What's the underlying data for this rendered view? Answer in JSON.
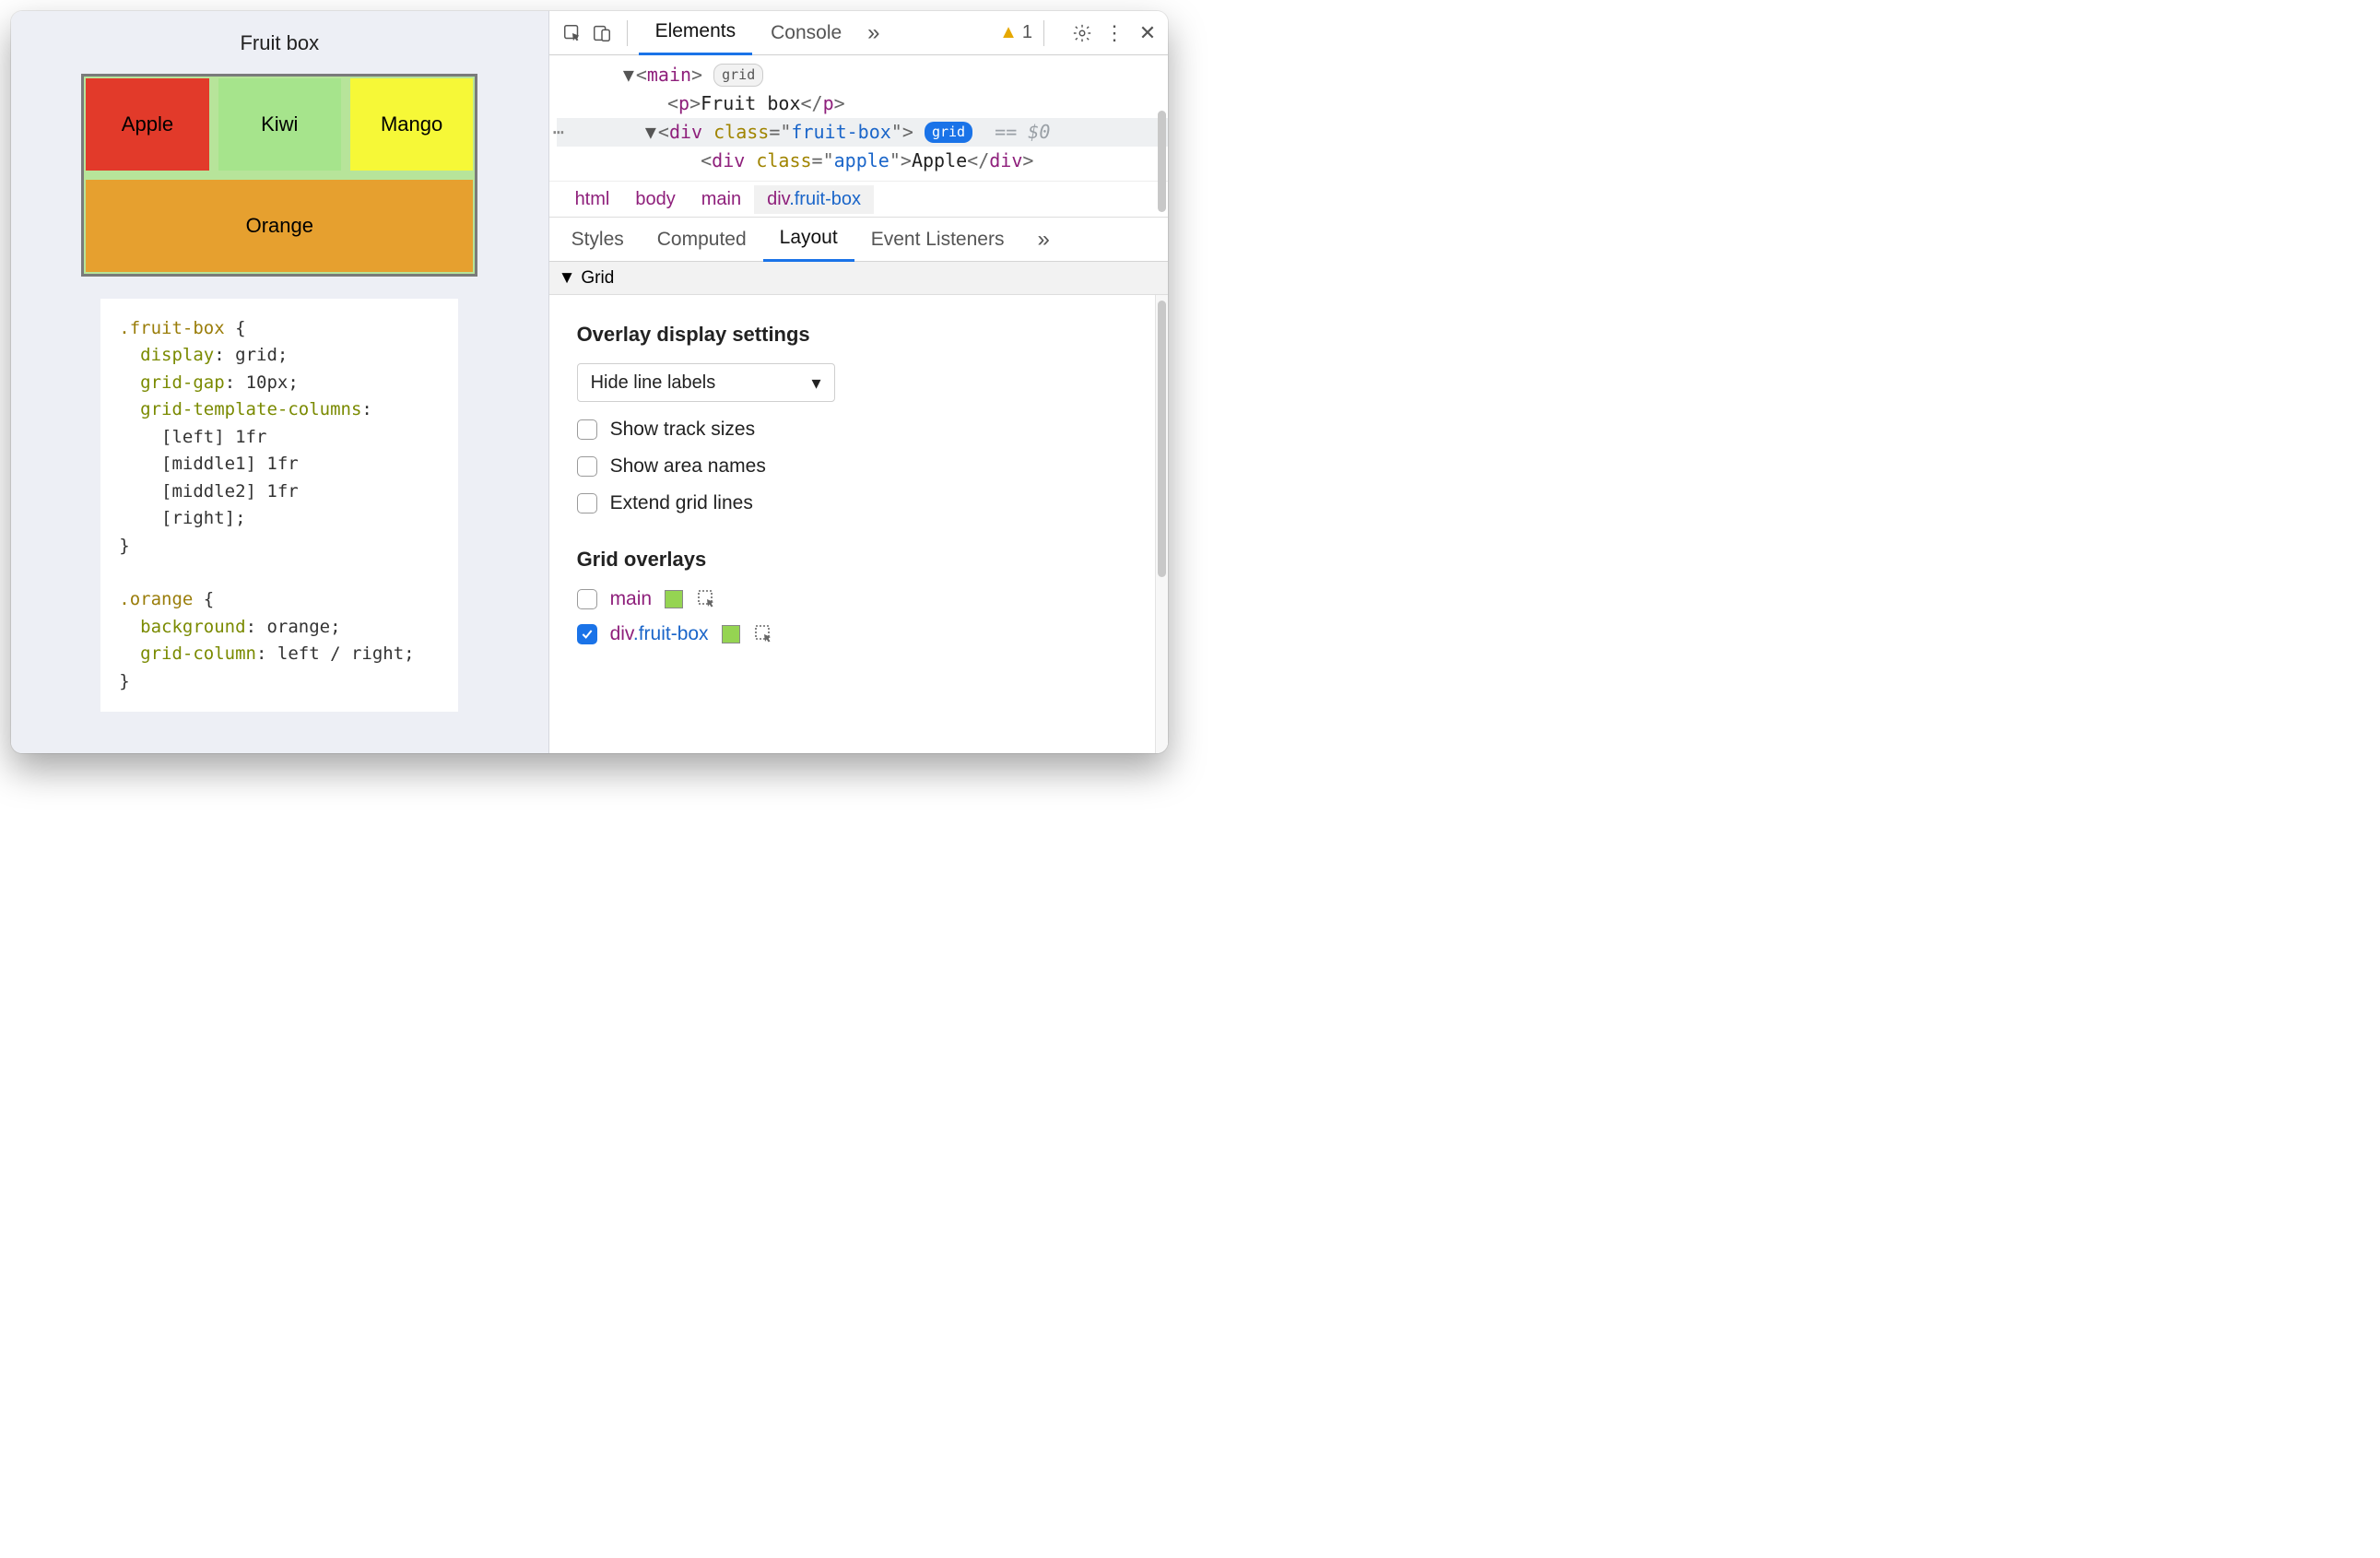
{
  "preview": {
    "title": "Fruit box",
    "cells": {
      "apple": "Apple",
      "kiwi": "Kiwi",
      "mango": "Mango",
      "orange": "Orange"
    },
    "code": ".fruit-box {\n  display: grid;\n  grid-gap: 10px;\n  grid-template-columns:\n    [left] 1fr\n    [middle1] 1fr\n    [middle2] 1fr\n    [right];\n}\n\n.orange {\n  background: orange;\n  grid-column: left / right;\n}"
  },
  "toolbar": {
    "tabs": {
      "elements": "Elements",
      "console": "Console"
    },
    "more": "»",
    "warning_count": "1"
  },
  "dom": {
    "main_tag": "main",
    "main_badge": "grid",
    "p_text": "Fruit box",
    "div_class": "fruit-box",
    "div_badge": "grid",
    "eq0": "== $0",
    "child_class": "apple",
    "child_text": "Apple"
  },
  "crumbs": [
    "html",
    "body",
    "main",
    "div.fruit-box"
  ],
  "subtabs": {
    "styles": "Styles",
    "computed": "Computed",
    "layout": "Layout",
    "listeners": "Event Listeners",
    "more": "»"
  },
  "grid": {
    "section": "Grid",
    "overlay_settings_title": "Overlay display settings",
    "line_labels_select": "Hide line labels",
    "show_track_sizes": "Show track sizes",
    "show_area_names": "Show area names",
    "extend_grid_lines": "Extend grid lines",
    "overlays_title": "Grid overlays",
    "overlays": [
      {
        "name": "main",
        "checked": false
      },
      {
        "name": "div.fruit-box",
        "checked": true
      }
    ]
  }
}
